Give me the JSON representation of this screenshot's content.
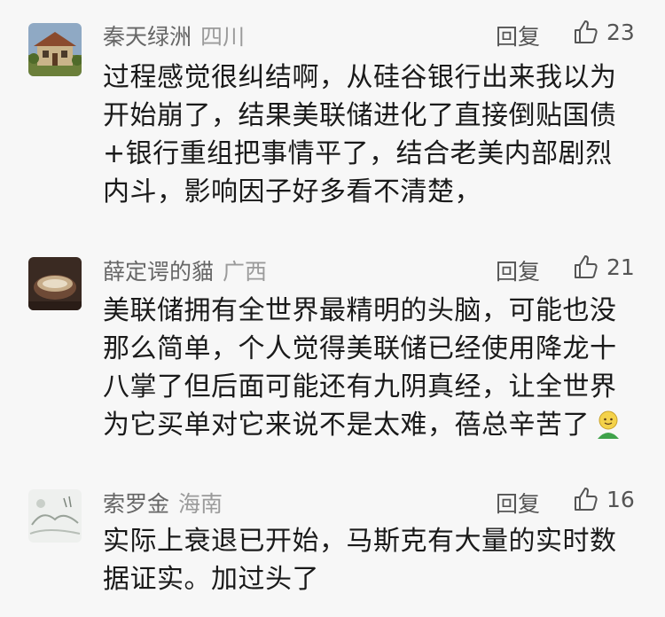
{
  "comments": [
    {
      "name": "秦天绿洲",
      "region": "四川",
      "reply_label": "回复",
      "likes": "23",
      "text": "过程感觉很纠结啊，从硅谷银行出来我以为\n开始崩了，结果美联储进化了直接倒贴国债\n+银行重组把事情平了，结合老美内部剧烈\n内斗，影响因子好多看不清楚，",
      "avatar_icon": "house-photo-avatar"
    },
    {
      "name": "薛定谔的貓",
      "region": "广西",
      "reply_label": "回复",
      "likes": "21",
      "text": "美联储拥有全世界最精明的头脑，可能也没\n那么简单，个人觉得美联储已经使用降龙十\n八掌了但后面可能还有九阴真经，让全世界\n为它买单对它来说不是太难，蓓总辛苦了",
      "trailing_emoji": "slightly-smiling-face-emoji",
      "avatar_icon": "bowl-photo-avatar"
    },
    {
      "name": "索罗金",
      "region": "海南",
      "reply_label": "回复",
      "likes": "16",
      "text": "实际上衰退已开始，马斯克有大量的实时数\n据证实。加过头了",
      "avatar_icon": "ink-painting-avatar"
    }
  ],
  "colors": {
    "background": "#f7f7f7",
    "name": "#666666",
    "region": "#9b9b9b",
    "text": "#1a1a1a"
  }
}
